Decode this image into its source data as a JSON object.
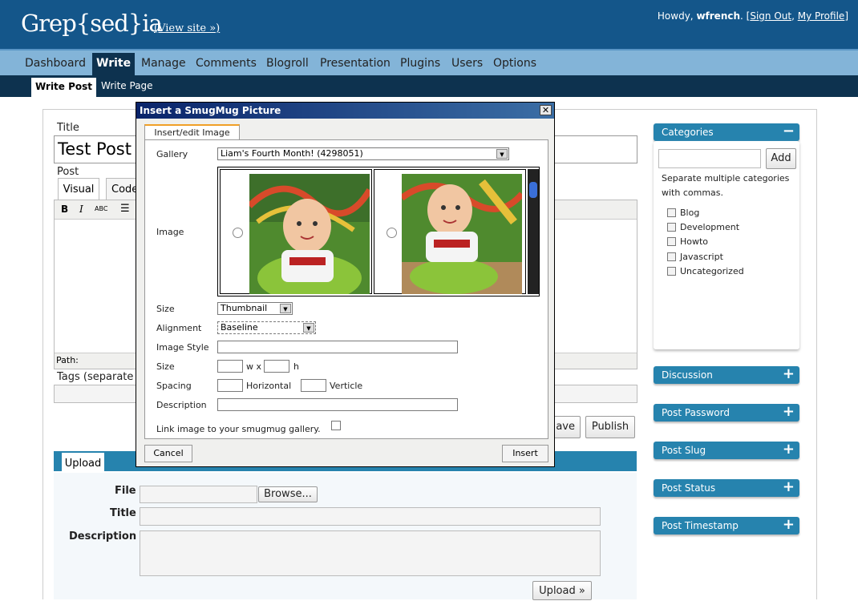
{
  "header": {
    "logo": "Grep{sed}ia",
    "view_site": "(View site »)",
    "howdy_prefix": "Howdy,",
    "user": "wfrench",
    "sign_out": "Sign Out",
    "my_profile": "My Profile"
  },
  "mainnav": [
    "Dashboard",
    "Write",
    "Manage",
    "Comments",
    "Blogroll",
    "Presentation",
    "Plugins",
    "Users",
    "Options"
  ],
  "subnav": [
    "Write Post",
    "Write Page"
  ],
  "editor": {
    "title_label": "Title",
    "title_value": "Test Post",
    "post_label": "Post",
    "tab_visual": "Visual",
    "tab_code": "Code",
    "path_label": "Path:",
    "tags_label": "Tags (separate m",
    "save_button": "ave",
    "publish_button": "Publish"
  },
  "upload": {
    "tab": "Upload",
    "file_label": "File",
    "browse": "Browse...",
    "title_label": "Title",
    "description_label": "Description",
    "upload_button": "Upload »"
  },
  "sidebar": {
    "categories_title": "Categories",
    "add_button": "Add",
    "hint": "Separate multiple categories with commas.",
    "categories": [
      "Blog",
      "Development",
      "Howto",
      "Javascript",
      "Uncategorized"
    ],
    "panels": [
      "Discussion",
      "Post Password",
      "Post Slug",
      "Post Status",
      "Post Timestamp"
    ]
  },
  "dialog": {
    "title": "Insert a SmugMug Picture",
    "tab": "Insert/edit Image",
    "gallery_label": "Gallery",
    "gallery_value": "Liam's Fourth Month! (4298051)",
    "image_label": "Image",
    "size_label": "Size",
    "size_value": "Thumbnail",
    "alignment_label": "Alignment",
    "alignment_value": "Baseline",
    "image_style_label": "Image Style",
    "size2_label": "Size",
    "w_label": "w x",
    "h_label": "h",
    "spacing_label": "Spacing",
    "horizontal_label": "Horizontal",
    "vertical_label": "Verticle",
    "description_label": "Description",
    "link_label": "Link image to your smugmug gallery.",
    "cancel": "Cancel",
    "insert": "Insert"
  }
}
